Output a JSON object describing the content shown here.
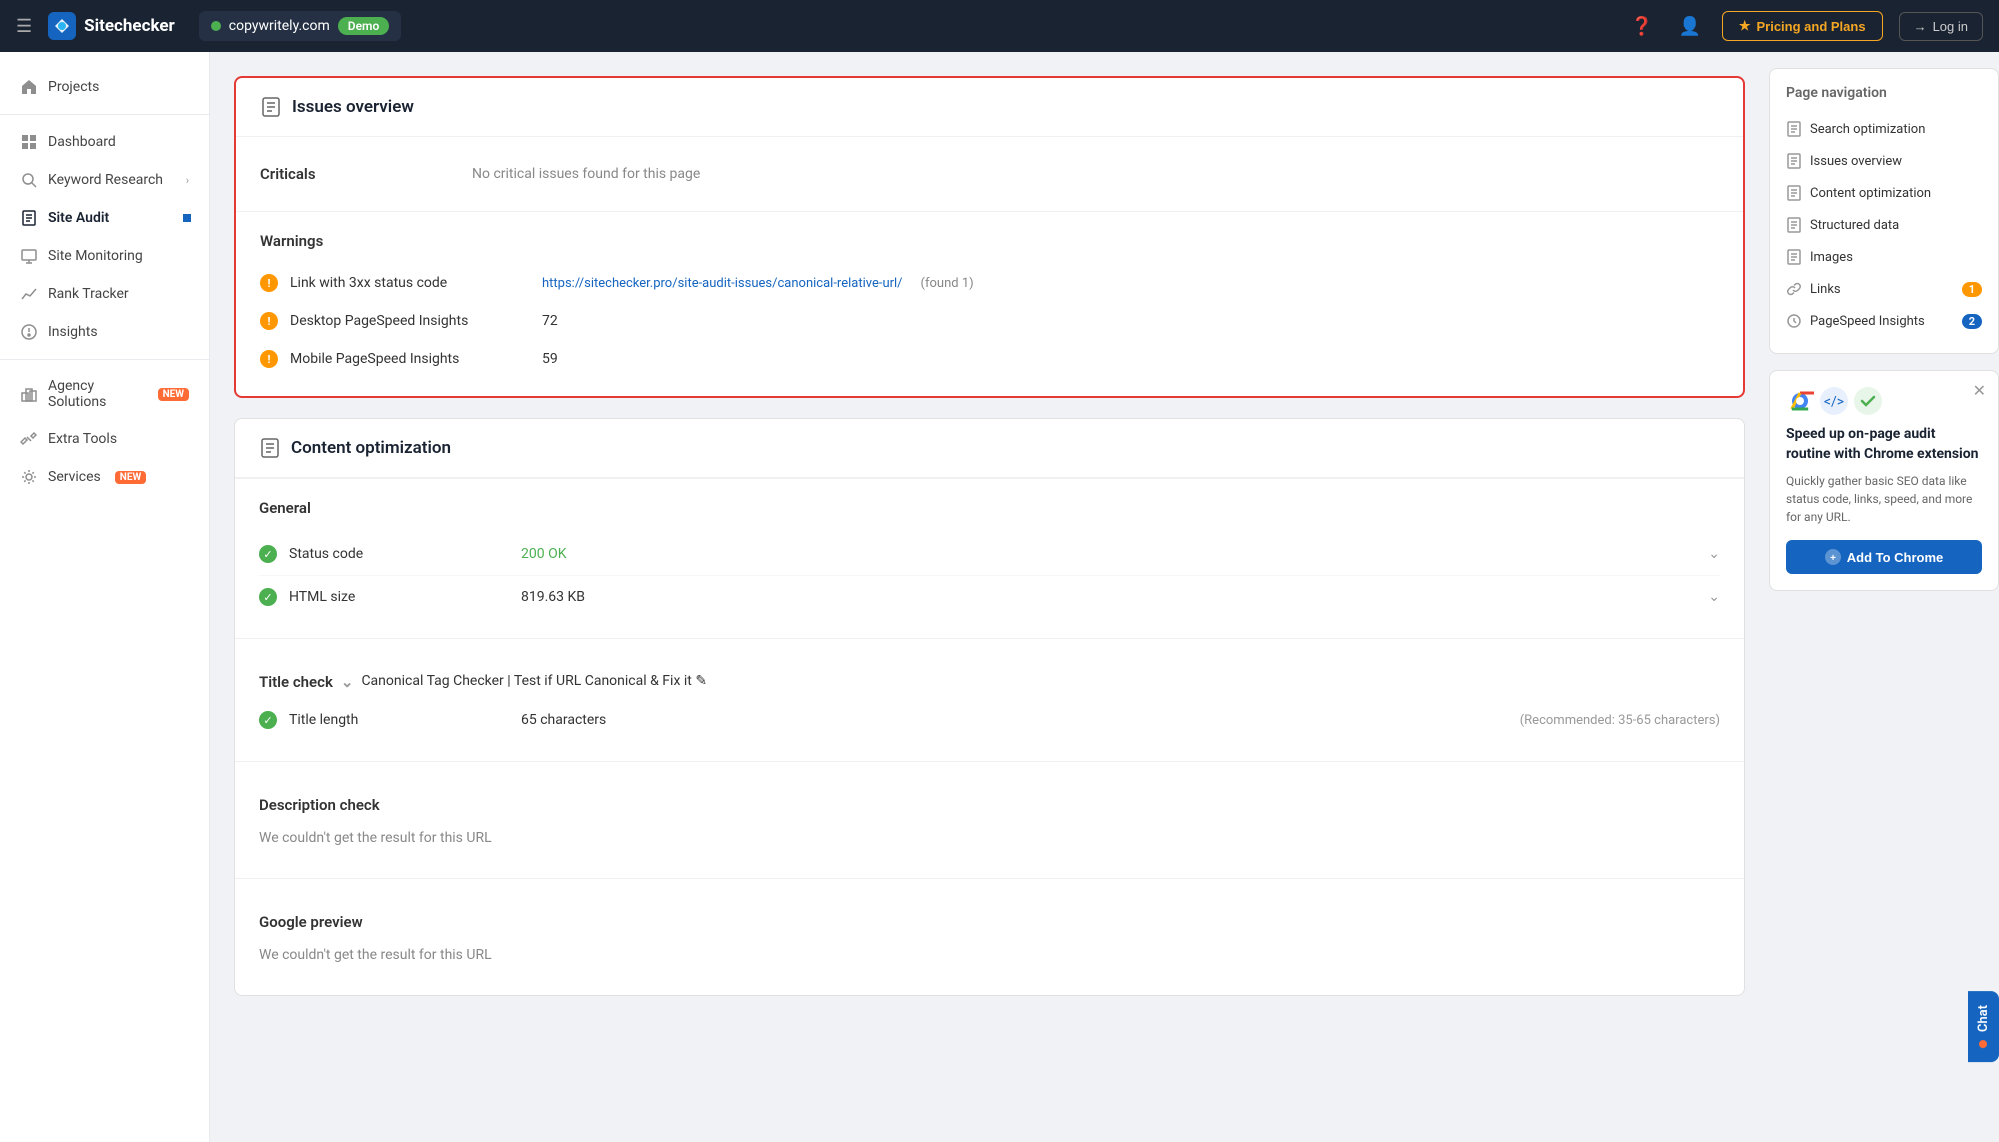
{
  "header": {
    "hamburger_icon": "☰",
    "logo_text": "Sitechecker",
    "site_url": "copywritely.com",
    "demo_label": "Demo",
    "help_icon": "?",
    "pricing_label": "Pricing and Plans",
    "login_label": "Log in"
  },
  "sidebar": {
    "items": [
      {
        "id": "projects",
        "label": "Projects",
        "icon": "home"
      },
      {
        "id": "dashboard",
        "label": "Dashboard",
        "icon": "grid"
      },
      {
        "id": "keyword-research",
        "label": "Keyword Research",
        "icon": "search",
        "chevron": true
      },
      {
        "id": "site-audit",
        "label": "Site Audit",
        "icon": "audit",
        "badge_dot": true
      },
      {
        "id": "site-monitoring",
        "label": "Site Monitoring",
        "icon": "monitor"
      },
      {
        "id": "rank-tracker",
        "label": "Rank Tracker",
        "icon": "chart"
      },
      {
        "id": "insights",
        "label": "Insights",
        "icon": "insights"
      },
      {
        "id": "agency-solutions",
        "label": "Agency Solutions",
        "icon": "agency",
        "badge_new": true
      },
      {
        "id": "extra-tools",
        "label": "Extra Tools",
        "icon": "tools"
      },
      {
        "id": "services",
        "label": "Services",
        "icon": "services",
        "badge_new": true
      }
    ]
  },
  "page_nav": {
    "title": "Page navigation",
    "items": [
      {
        "id": "search-optimization",
        "label": "Search optimization",
        "icon": "doc"
      },
      {
        "id": "issues-overview",
        "label": "Issues overview",
        "icon": "doc"
      },
      {
        "id": "content-optimization",
        "label": "Content optimization",
        "icon": "doc"
      },
      {
        "id": "structured-data",
        "label": "Structured data",
        "icon": "doc"
      },
      {
        "id": "images",
        "label": "Images",
        "icon": "doc"
      },
      {
        "id": "links",
        "label": "Links",
        "icon": "doc",
        "badge": "1",
        "badge_type": "orange"
      },
      {
        "id": "pagespeed-insights",
        "label": "PageSpeed Insights",
        "icon": "doc",
        "badge": "2",
        "badge_type": "blue"
      }
    ]
  },
  "chrome_promo": {
    "close_icon": "✕",
    "title": "Speed up on-page audit routine with Chrome extension",
    "description": "Quickly gather basic SEO data like status code, links, speed, and more for any URL.",
    "button_label": "Add To Chrome"
  },
  "issues_overview": {
    "title": "Issues overview",
    "criticals_label": "Criticals",
    "criticals_text": "No critical issues found for this page",
    "warnings_label": "Warnings",
    "warnings": [
      {
        "id": "link-3xx",
        "label": "Link with 3xx status code",
        "link_url": "https://sitechecker.pro/site-audit-issues/canonical-relative-url/",
        "link_text": "https://sitechecker.pro/site-audit-issues/canonical-relative-url/",
        "found_text": "(found 1)"
      },
      {
        "id": "desktop-pagespeed",
        "label": "Desktop PageSpeed Insights",
        "value": "72"
      },
      {
        "id": "mobile-pagespeed",
        "label": "Mobile PageSpeed Insights",
        "value": "59"
      }
    ]
  },
  "content_optimization": {
    "title": "Content optimization",
    "general_label": "General",
    "general_items": [
      {
        "id": "status-code",
        "label": "Status code",
        "value": "200 OK",
        "value_color": "green",
        "has_chevron": true
      },
      {
        "id": "html-size",
        "label": "HTML size",
        "value": "819.63 KB",
        "has_chevron": true
      }
    ],
    "title_check_label": "Title check",
    "title_check_value": "Canonical Tag Checker | Test if URL Canonical & Fix it ✎",
    "title_check_chevron": true,
    "title_items": [
      {
        "id": "title-length",
        "label": "Title length",
        "value": "65 characters",
        "sub_value": "(Recommended: 35-65 characters)",
        "has_chevron": false
      }
    ],
    "description_check_label": "Description check",
    "description_check_value": "We couldn't get the result for this URL",
    "google_preview_label": "Google preview",
    "google_preview_value": "We couldn't get the result for this URL"
  },
  "chat": {
    "label": "Chat",
    "dot": true
  }
}
